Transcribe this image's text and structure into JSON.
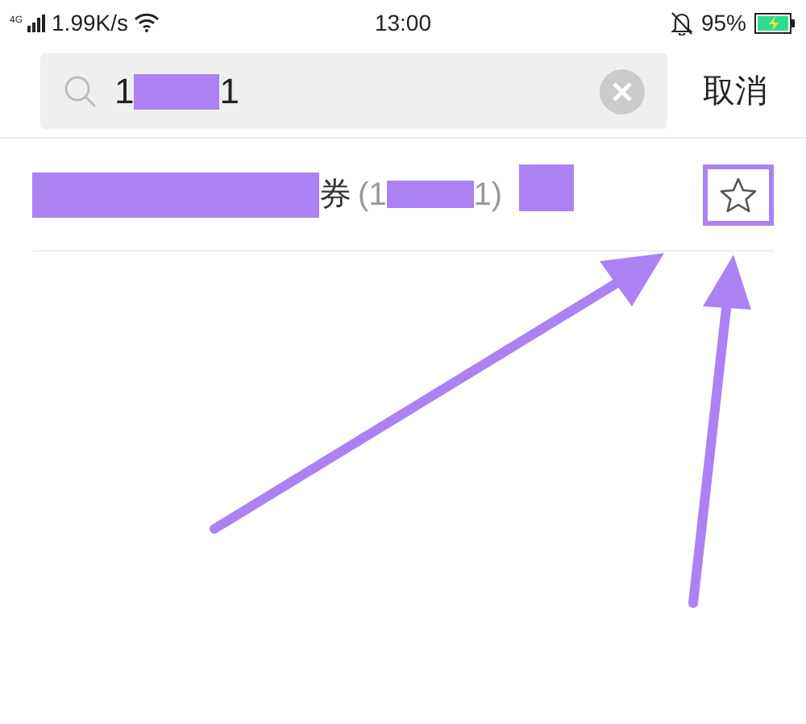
{
  "status_bar": {
    "network": "4G",
    "speed": "1.99K/s",
    "time": "13:00",
    "battery": "95%",
    "charging": true
  },
  "search": {
    "value_start": "1",
    "value_end": "1",
    "cancel": "取消"
  },
  "results": [
    {
      "name_tail": "券",
      "code_start": "(1",
      "code_end": "1)",
      "starred": false
    }
  ]
}
